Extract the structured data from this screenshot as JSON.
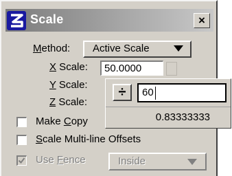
{
  "window": {
    "title": "Scale",
    "close_label": "×",
    "app_icon": "microstation-logo"
  },
  "method": {
    "label_mnemonic": "M",
    "label_rest": "ethod:",
    "selected": "Active Scale"
  },
  "x_scale": {
    "mnemonic": "X",
    "rest": " Scale:",
    "value": "50.0000"
  },
  "y_scale": {
    "mnemonic": "Y",
    "rest": " Scale:"
  },
  "z_scale": {
    "mnemonic": "Z",
    "rest": " Scale:"
  },
  "calculator_popup": {
    "operator": "÷",
    "input_value": "60",
    "result": "0.83333333"
  },
  "make_copy": {
    "before": "Make ",
    "mnemonic": "C",
    "after": "opy",
    "checked": false
  },
  "multiline": {
    "mnemonic": "S",
    "after": "cale Multi-line Offsets",
    "checked": false
  },
  "use_fence": {
    "before": "Use ",
    "mnemonic": "F",
    "after": "ence",
    "checked": true,
    "enabled": false,
    "mode": "Inside"
  }
}
